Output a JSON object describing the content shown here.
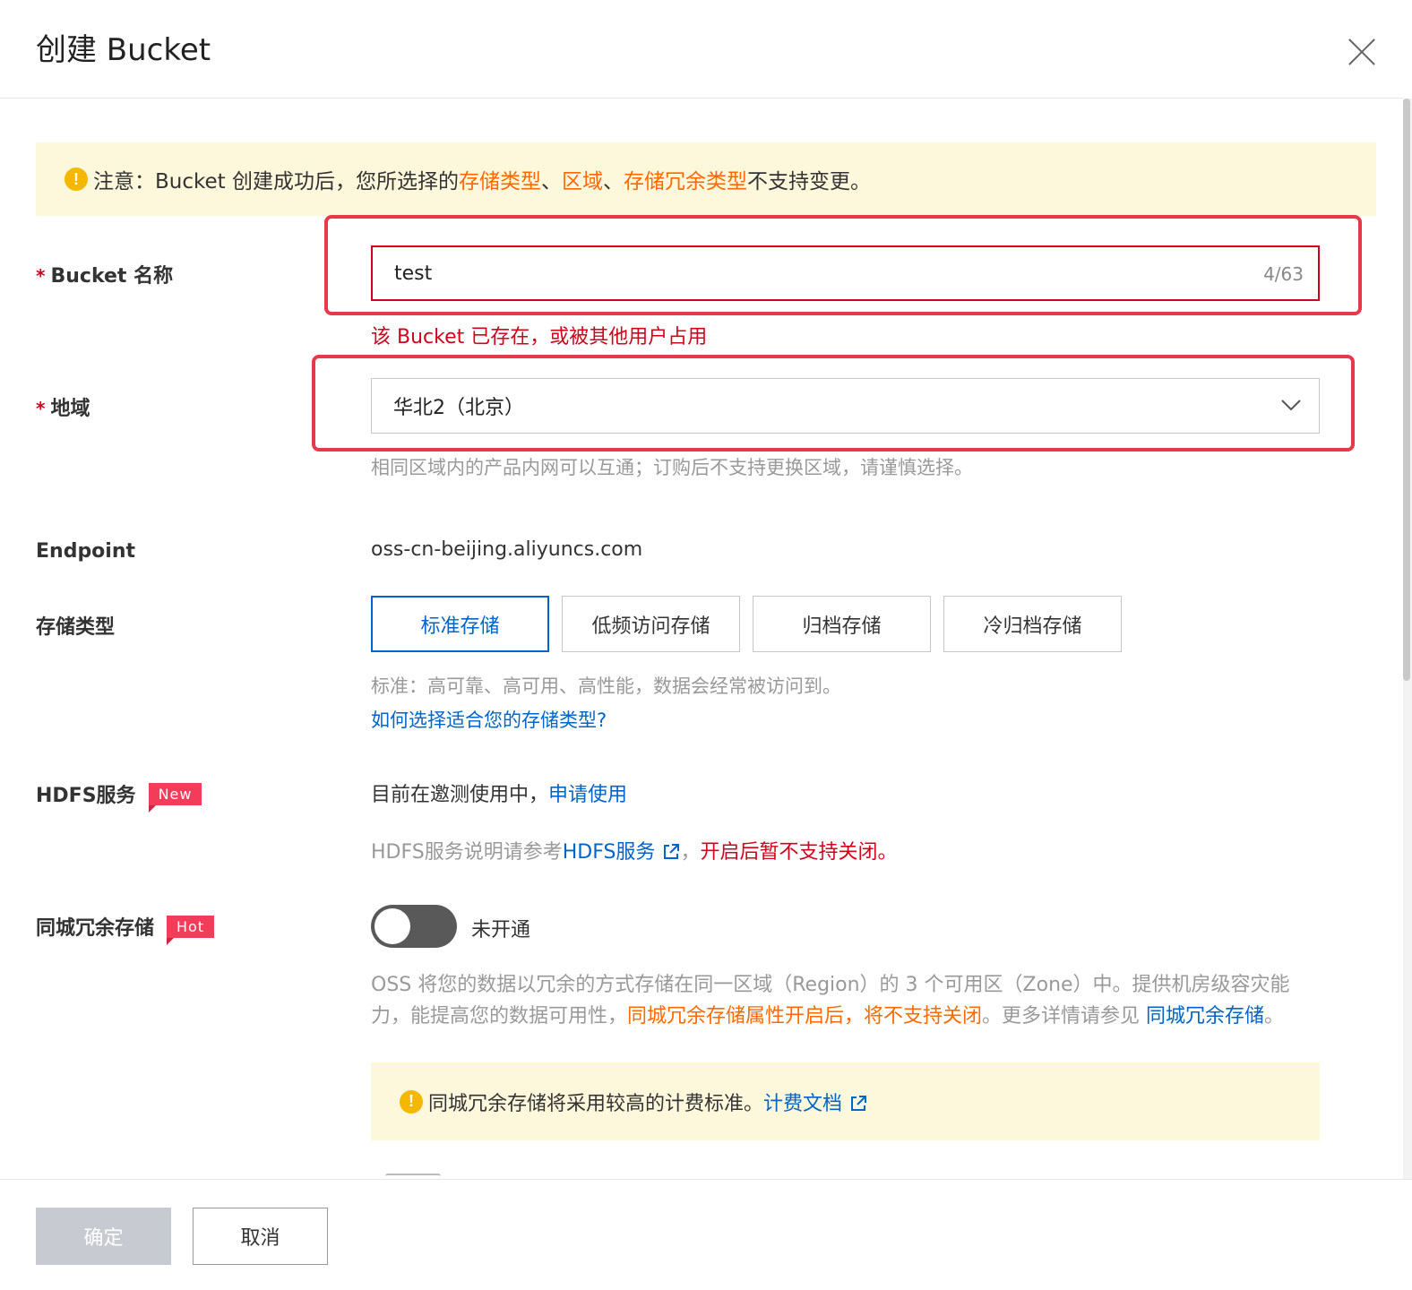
{
  "dialog": {
    "title": "创建 Bucket",
    "close_icon": "close-icon"
  },
  "notice": {
    "prefix": "注意：Bucket 创建成功后，您所选择的 ",
    "link1": "存储类型",
    "sep1": "、",
    "link2": "区域",
    "sep2": "、",
    "link3": "存储冗余类型",
    "suffix": " 不支持变更。",
    "icon": "warning-icon"
  },
  "bucket_name": {
    "required_mark": "*",
    "label": "Bucket 名称",
    "value": "test",
    "counter": "4/63",
    "error": "该 Bucket 已存在，或被其他用户占用"
  },
  "region": {
    "required_mark": "*",
    "label": "地域",
    "value": "华北2（北京）",
    "help": "相同区域内的产品内网可以互通；订购后不支持更换区域，请谨慎选择。"
  },
  "endpoint": {
    "label": "Endpoint",
    "value": "oss-cn-beijing.aliyuncs.com"
  },
  "storage_type": {
    "label": "存储类型",
    "options": [
      "标准存储",
      "低频访问存储",
      "归档存储",
      "冷归档存储"
    ],
    "selected": "标准存储",
    "help": "标准：高可靠、高可用、高性能，数据会经常被访问到。",
    "link": "如何选择适合您的存储类型?"
  },
  "hdfs": {
    "label": "HDFS服务",
    "badge": "New",
    "status": "目前在邀测使用中，",
    "apply_link": "申请使用",
    "note_prefix": "HDFS服务说明请参考",
    "note_link": "HDFS服务",
    "note_sep": "，",
    "note_warning": "开启后暂不支持关闭。"
  },
  "zrs": {
    "label": "同城冗余存储",
    "badge": "Hot",
    "toggle_state": "未开通",
    "toggle_on": false,
    "desc_part1": "OSS 将您的数据以冗余的方式存储在同一区域（Region）的 3 个可用区（Zone）中。提供机房级容灾能力，能提高您的数据可用性，",
    "desc_warning": "同城冗余存储属性开启后，将不支持关闭",
    "desc_part2": "。更多详情请参见 ",
    "desc_link": "同城冗余存储",
    "desc_end": "。",
    "tip_text": "同城冗余存储将采用较高的计费标准。",
    "tip_link": "计费文档"
  },
  "footer": {
    "ok_label": "确定",
    "cancel_label": "取消"
  },
  "colors": {
    "accent": "#0064c8",
    "error": "#d0021b",
    "warning": "#ff6a00",
    "highlight": "#e8394a"
  }
}
